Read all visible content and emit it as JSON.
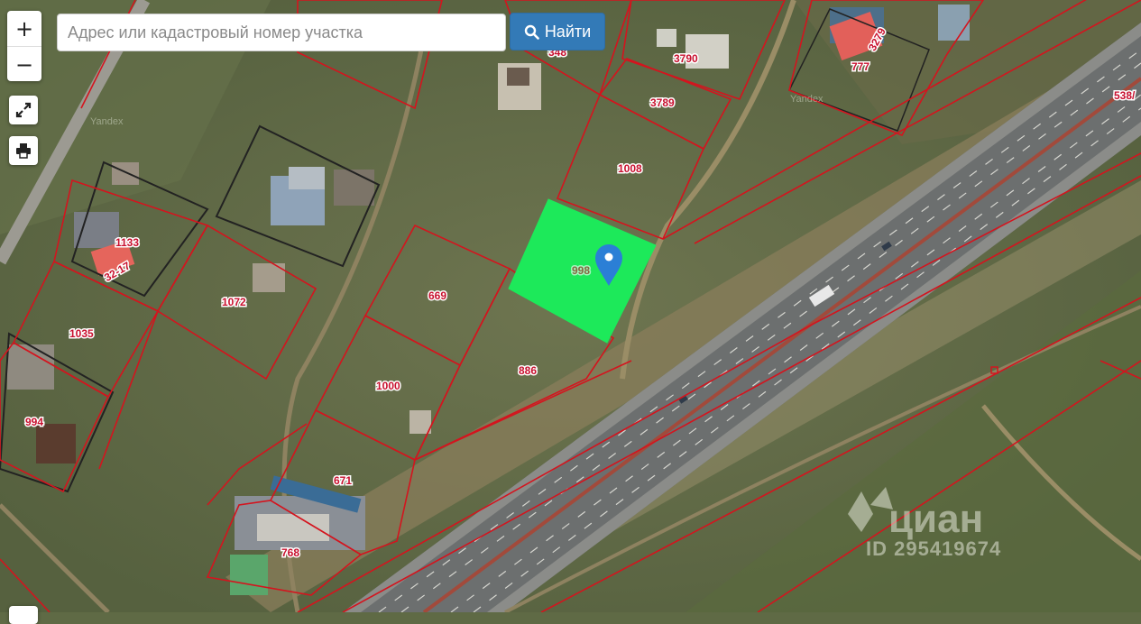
{
  "search": {
    "placeholder": "Адрес или кадастровый номер участка",
    "value": "",
    "button_label": "Найти",
    "button_icon": "search-icon"
  },
  "controls": {
    "zoom_in_label": "+",
    "zoom_out_label": "−",
    "fullscreen_icon": "expand-icon",
    "print_icon": "printer-icon"
  },
  "map": {
    "provider_watermark": "Yandex",
    "selected_parcel_number": "998",
    "selected_parcel_color": "#1de95a",
    "boundary_color": "#d4141e",
    "marker_color": "#2b7fd6",
    "parcel_numbers": [
      "998",
      "3790",
      "3789",
      "1008",
      "777",
      "3279",
      "538/",
      "1133",
      "32-17",
      "1072",
      "1035",
      "669",
      "886",
      "1000",
      "994",
      "671",
      "768"
    ],
    "partial_label": "348"
  },
  "watermark": {
    "brand": "циан",
    "listing_id": "ID 295419674"
  }
}
